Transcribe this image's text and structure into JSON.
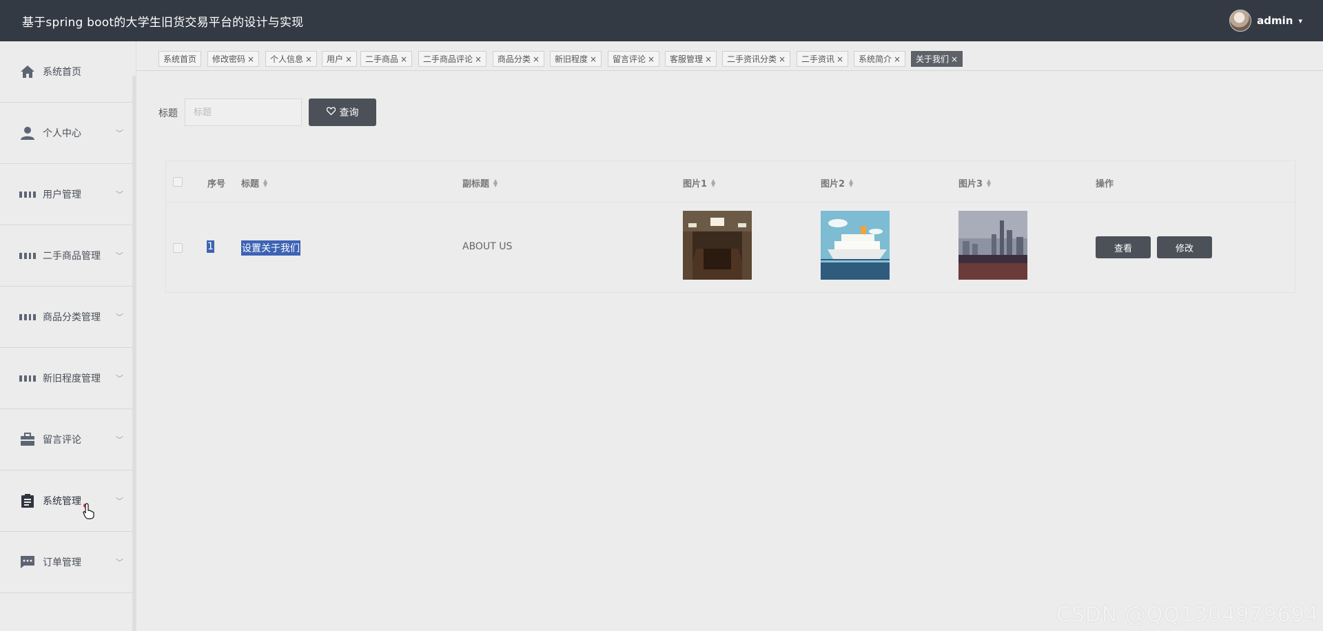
{
  "header": {
    "title": "基于spring boot的大学生旧货交易平台的设计与实现",
    "username": "admin",
    "caret": "▾"
  },
  "sidebar": {
    "items": [
      {
        "label": "系统首页",
        "icon": "home-icon",
        "expandable": false
      },
      {
        "label": "个人中心",
        "icon": "person-icon",
        "expandable": true
      },
      {
        "label": "用户管理",
        "icon": "grid-icon",
        "expandable": true
      },
      {
        "label": "二手商品管理",
        "icon": "grid-icon",
        "expandable": true
      },
      {
        "label": "商品分类管理",
        "icon": "grid-icon",
        "expandable": true
      },
      {
        "label": "新旧程度管理",
        "icon": "grid-icon",
        "expandable": true
      },
      {
        "label": "留言评论",
        "icon": "briefcase-icon",
        "expandable": true
      },
      {
        "label": "系统管理",
        "icon": "clipboard-icon",
        "expandable": true
      },
      {
        "label": "订单管理",
        "icon": "chat-icon",
        "expandable": true
      }
    ]
  },
  "tabs": [
    {
      "label": "系统首页",
      "closable": false
    },
    {
      "label": "修改密码",
      "closable": true
    },
    {
      "label": "个人信息",
      "closable": true
    },
    {
      "label": "用户",
      "closable": true
    },
    {
      "label": "二手商品",
      "closable": true
    },
    {
      "label": "二手商品评论",
      "closable": true
    },
    {
      "label": "商品分类",
      "closable": true
    },
    {
      "label": "新旧程度",
      "closable": true
    },
    {
      "label": "留言评论",
      "closable": true
    },
    {
      "label": "客服管理",
      "closable": true
    },
    {
      "label": "二手资讯分类",
      "closable": true
    },
    {
      "label": "二手资讯",
      "closable": true
    },
    {
      "label": "系统简介",
      "closable": true
    },
    {
      "label": "关于我们",
      "closable": true,
      "active": true
    }
  ],
  "search": {
    "label": "标题",
    "placeholder": "标题",
    "button_label": "查询"
  },
  "table": {
    "columns": {
      "index": "序号",
      "title": "标题",
      "subtitle": "副标题",
      "pic1": "图片1",
      "pic2": "图片2",
      "pic3": "图片3",
      "actions": "操作"
    },
    "rows": [
      {
        "index": "1",
        "title": "设置关于我们",
        "subtitle": "ABOUT US",
        "pic1": "meeting-room-image",
        "pic2": "cruise-ship-image",
        "pic3": "city-skyline-image",
        "view_label": "查看",
        "edit_label": "修改"
      }
    ]
  },
  "watermark": "CSDN @QQ1304979694",
  "colors": {
    "header_bg": "#343a44",
    "button_bg": "#4c5058",
    "active_tab": "#5d6168",
    "selection": "#3d63b5",
    "notification_dot": "#e02f2f"
  }
}
